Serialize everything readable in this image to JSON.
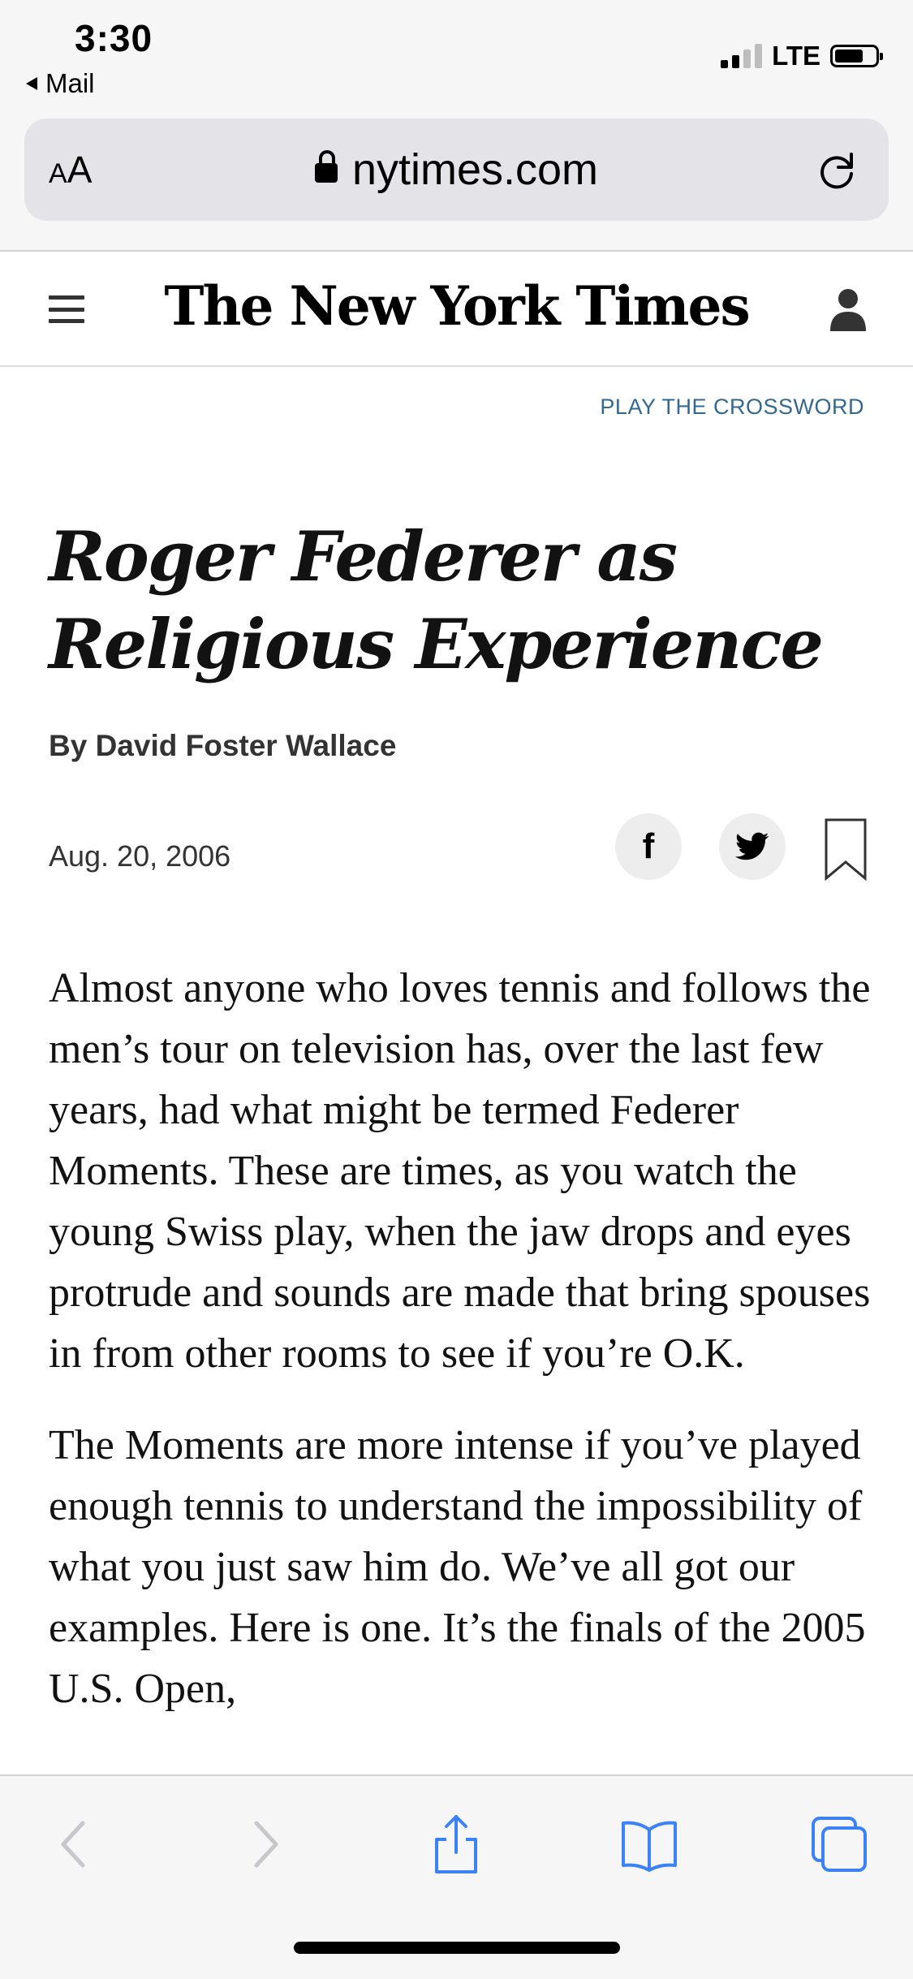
{
  "status_bar": {
    "time": "3:30",
    "back_app": "Mail",
    "network": "LTE"
  },
  "address_bar": {
    "text_size_label": "AA",
    "url": "nytimes.com"
  },
  "masthead": {
    "logo": "The New York Times"
  },
  "crossword_link": "PLAY THE CROSSWORD",
  "article": {
    "headline": "Roger Federer as Religious Experience",
    "byline": "By David Foster Wallace",
    "date": "Aug. 20, 2006",
    "paragraphs": [
      "Almost anyone who loves tennis and follows the men’s tour on television has, over the last few years, had what might be termed Federer Moments. These are times, as you watch the young Swiss play, when the jaw drops and eyes protrude and sounds are made that bring spouses in from other rooms to see if you’re O.K.",
      "The Moments are more intense if you’ve played enough tennis to understand the impossibility of what you just saw him do. We’ve all got our examples. Here is one. It’s the finals of the 2005 U.S. Open,"
    ]
  },
  "share": {
    "facebook_glyph": "f"
  },
  "colors": {
    "link": "#326891",
    "chrome_background": "#f6f6f7",
    "toolbar_accent": "#3b82f6",
    "toolbar_disabled": "#c7c7cc"
  },
  "icons": {
    "address_bar": [
      "lock-icon",
      "reload-icon"
    ],
    "masthead": [
      "hamburger-menu-icon",
      "account-icon"
    ],
    "share": [
      "facebook-icon",
      "twitter-icon",
      "bookmark-icon"
    ],
    "toolbar": [
      "back-arrow-icon",
      "forward-arrow-icon",
      "share-icon",
      "bookmarks-icon",
      "tabs-icon"
    ]
  }
}
